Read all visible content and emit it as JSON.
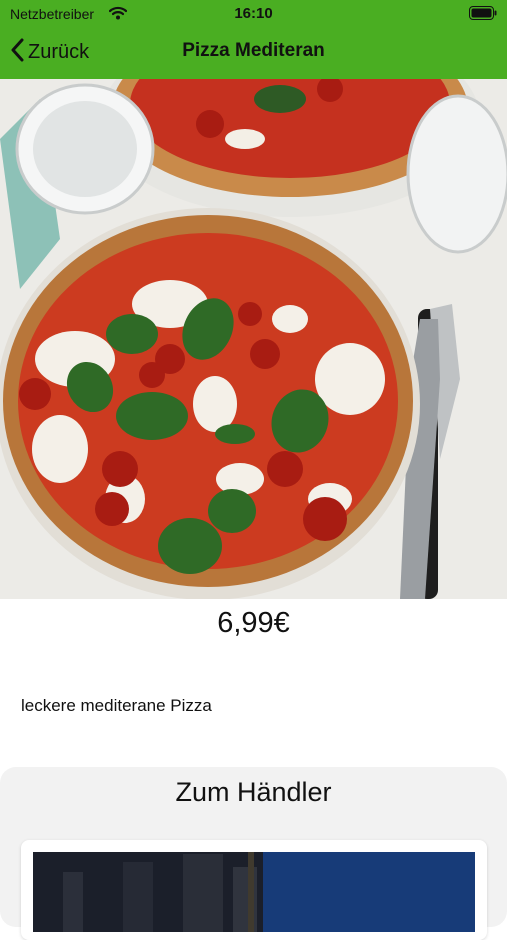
{
  "status": {
    "carrier": "Netzbetreiber",
    "time": "16:10"
  },
  "nav": {
    "back_label": "Zurück",
    "title": "Pizza Mediteran"
  },
  "product": {
    "price": "6,99€",
    "description": "leckere mediterane Pizza"
  },
  "dealer": {
    "title": "Zum Händler"
  },
  "colors": {
    "nav_bar": "#4aae22",
    "card_bg": "#f2f2f2"
  },
  "icons": {
    "wifi": "wifi-icon",
    "battery": "battery-icon",
    "back": "chevron-left-icon"
  }
}
